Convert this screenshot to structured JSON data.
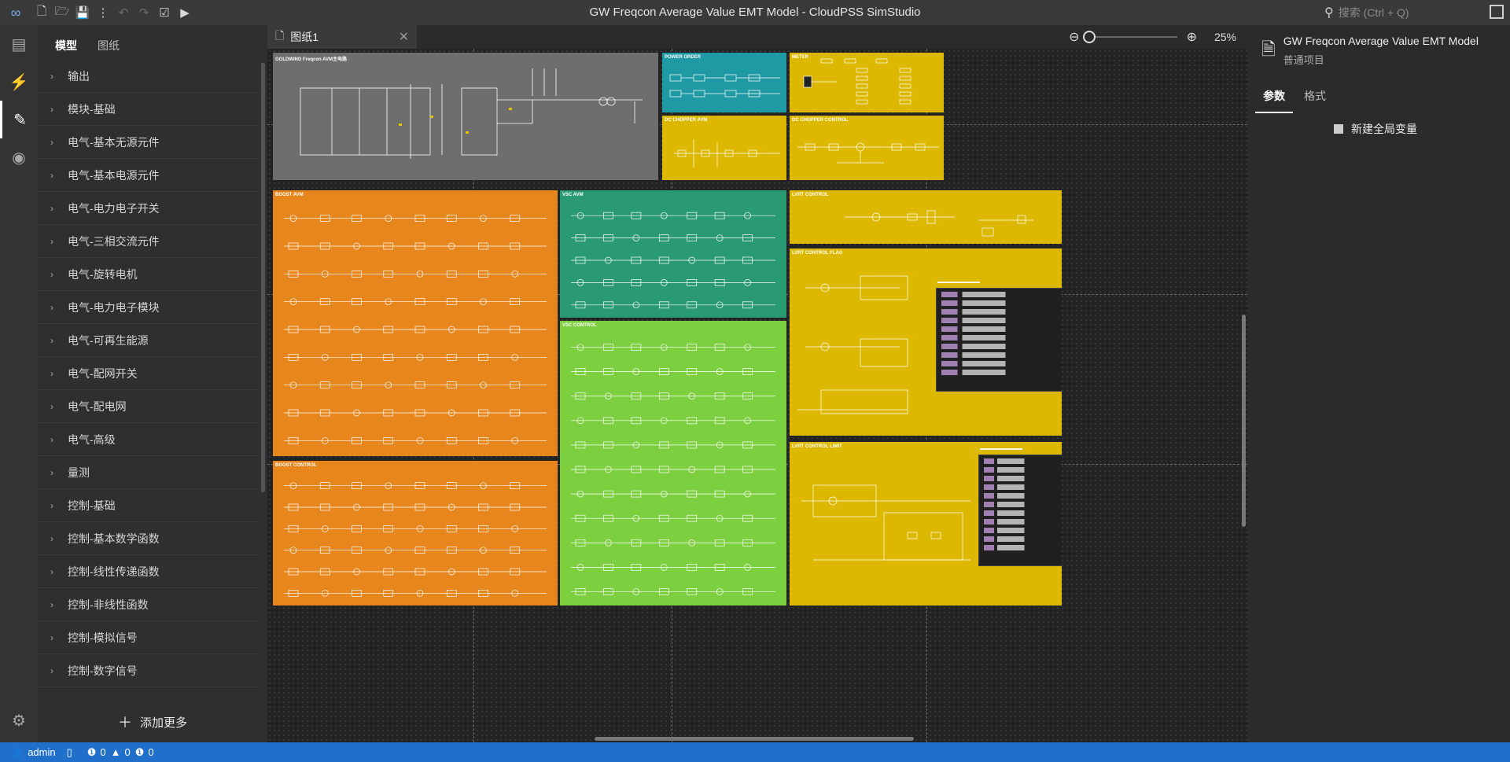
{
  "app": {
    "title": "GW Freqcon Average Value EMT Model - CloudPSS SimStudio",
    "search_placeholder": "搜索 (Ctrl + Q)"
  },
  "toolbar": {
    "icons": [
      "logo-icon",
      "new-file-icon",
      "open-folder-icon",
      "save-icon",
      "more-icon",
      "undo-icon",
      "redo-icon",
      "checklist-icon",
      "run-icon"
    ]
  },
  "activity_bar": [
    "overview-icon",
    "plugin-icon",
    "tools-icon",
    "play-icon",
    "settings-icon"
  ],
  "left_panel": {
    "tabs": [
      "模型",
      "图纸"
    ],
    "active_tab": "模型",
    "categories": [
      "输出",
      "模块-基础",
      "电气-基本无源元件",
      "电气-基本电源元件",
      "电气-电力电子开关",
      "电气-三相交流元件",
      "电气-旋转电机",
      "电气-电力电子模块",
      "电气-可再生能源",
      "电气-配网开关",
      "电气-配电网",
      "电气-高级",
      "量测",
      "控制-基础",
      "控制-基本数学函数",
      "控制-线性传递函数",
      "控制-非线性函数",
      "控制-模拟信号",
      "控制-数字信号"
    ],
    "add_more": "添加更多"
  },
  "editor": {
    "tab_label": "图纸1",
    "zoom_value": "25%",
    "blocks": [
      {
        "id": "goldwind",
        "title": "GOLDWIND Freqcon AVM主电路",
        "color": "#6e6e6e"
      },
      {
        "id": "power-order",
        "title": "POWER ORDER",
        "color": "#1f9aa5"
      },
      {
        "id": "meter",
        "title": "METER",
        "color": "#dcb800"
      },
      {
        "id": "dc-chopper-avm",
        "title": "DC CHOPPER AVM",
        "color": "#dcb800"
      },
      {
        "id": "dc-chopper-control",
        "title": "DC CHOPPER CONTROL",
        "color": "#dcb800"
      },
      {
        "id": "boost-avm",
        "title": "BOOST AVM",
        "color": "#e6861c"
      },
      {
        "id": "vsc-avm",
        "title": "VSC AVM",
        "color": "#2a9a72"
      },
      {
        "id": "lvrt-control",
        "title": "LVRT CONTROL",
        "color": "#dcb800"
      },
      {
        "id": "lvrt-control-flag",
        "title": "LVRT CONTROL FLAG",
        "color": "#dcb800"
      },
      {
        "id": "vsc-control",
        "title": "VSC CONTROL",
        "color": "#7ccf3f"
      },
      {
        "id": "boost-control",
        "title": "BOOST CONTROL",
        "color": "#e6861c"
      },
      {
        "id": "lvrt-control-limit",
        "title": "LVRT CONTROL LIMIT",
        "color": "#dcb800"
      }
    ]
  },
  "right_panel": {
    "project_title": "GW Freqcon Average Value EMT Model",
    "project_type": "普通项目",
    "tabs": [
      "参数",
      "格式"
    ],
    "active_tab": "参数",
    "new_global_var": "新建全局变量"
  },
  "status_bar": {
    "user": "admin",
    "errors": "0",
    "warnings": "0",
    "infos": "0"
  }
}
